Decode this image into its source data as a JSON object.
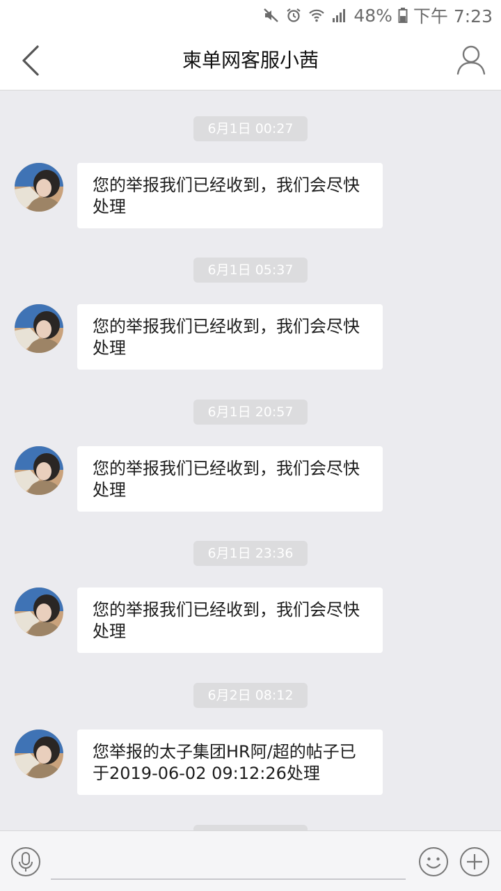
{
  "status_bar": {
    "battery": "48%",
    "time": "下午 7:23",
    "icons": [
      "mute-icon",
      "alarm-icon",
      "wifi-icon",
      "signal-icon",
      "battery-icon"
    ]
  },
  "header": {
    "title": "柬单网客服小茜",
    "back_icon": "chevron-left-icon",
    "profile_icon": "person-icon"
  },
  "messages": [
    {
      "time": "6月1日 00:27",
      "text": "您的举报我们已经收到，我们会尽快处理"
    },
    {
      "time": "6月1日 05:37",
      "text": "您的举报我们已经收到，我们会尽快处理"
    },
    {
      "time": "6月1日 20:57",
      "text": "您的举报我们已经收到，我们会尽快处理"
    },
    {
      "time": "6月1日 23:36",
      "text": "您的举报我们已经收到，我们会尽快处理"
    },
    {
      "time": "6月2日 08:12",
      "text": "您举报的太子集团HR阿/超的帖子已于2019-06-02 09:12:26处理"
    }
  ],
  "input_bar": {
    "text_value": "",
    "icons": [
      "microphone-icon",
      "emoji-icon",
      "plus-icon"
    ]
  },
  "colors": {
    "chat_background": "#ebebef",
    "bubble": "#ffffff",
    "time_pill": "#dcdcde",
    "icon_gray": "#6b6b6b"
  }
}
